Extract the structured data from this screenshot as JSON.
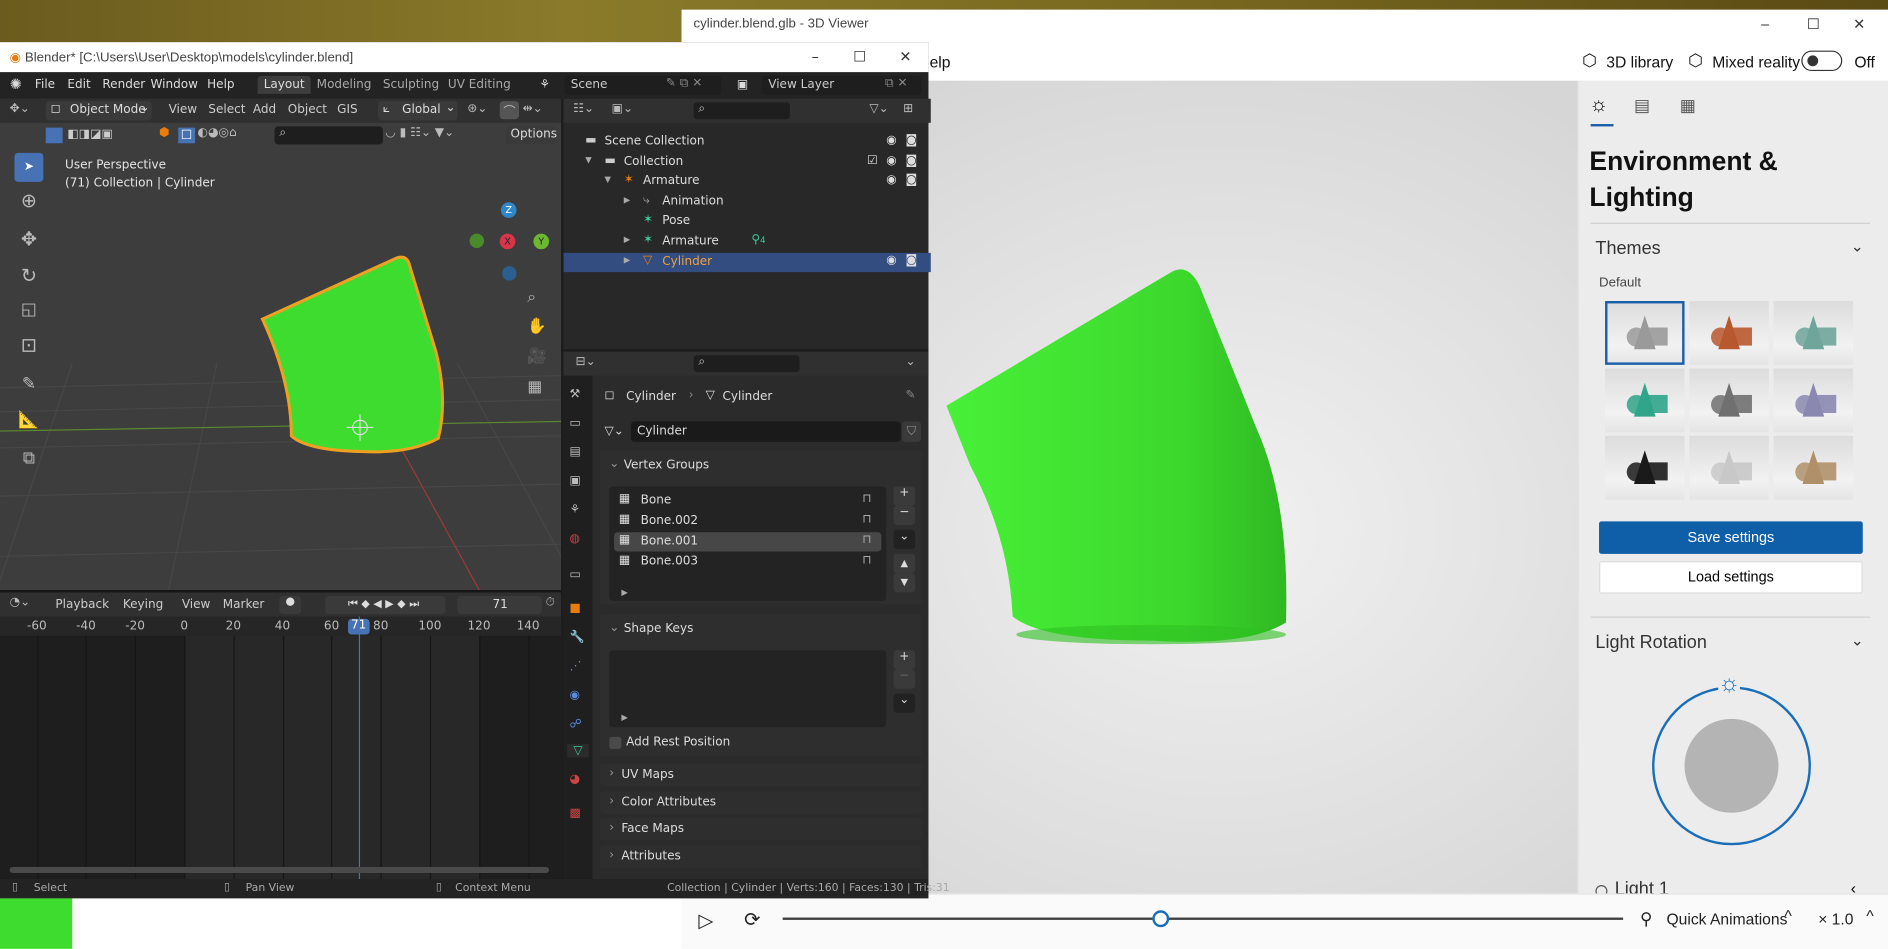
{
  "viewer": {
    "title": "cylinder.blend.glb - 3D Viewer",
    "menu_partial": "elp",
    "library_label": "3D library",
    "mixed_reality_label": "Mixed reality",
    "mixed_reality_state": "Off",
    "panel": {
      "tabs": [
        "sun-icon",
        "stats-icon",
        "grid-icon"
      ],
      "title_line1": "Environment &",
      "title_line2": "Lighting",
      "themes_label": "Themes",
      "themes_selected": "Default",
      "theme_colors": [
        "#9a9a9a",
        "#b8582e",
        "#6fa59a",
        "#2fa58a",
        "#707070",
        "#8a88b0",
        "#1a1a1a",
        "#c8c8c8",
        "#b0906a"
      ],
      "save_label": "Save settings",
      "load_label": "Load settings",
      "light_rotation_label": "Light Rotation",
      "light1_label": "Light 1"
    },
    "playback": {
      "progress": 0.45,
      "quick_animations_label": "Quick Animations",
      "speed": "× 1.0"
    },
    "model_color": "#3ddc2e"
  },
  "blender": {
    "title": "Blender* [C:\\Users\\User\\Desktop\\models\\cylinder.blend]",
    "menu": [
      "File",
      "Edit",
      "Render",
      "Window",
      "Help"
    ],
    "workspaces": [
      "Layout",
      "Modeling",
      "Sculpting",
      "UV Editing"
    ],
    "active_workspace": "Layout",
    "scene": "Scene",
    "view_layer": "View Layer",
    "viewport": {
      "mode": "Object Mode",
      "menus": [
        "View",
        "Select",
        "Add",
        "Object",
        "GIS"
      ],
      "orientation": "Global",
      "options_label": "Options",
      "overlay_line1": "User Perspective",
      "overlay_line2": "(71) Collection | Cylinder",
      "gizmo": {
        "z": "Z",
        "y": "Y",
        "x": "X"
      }
    },
    "outliner": [
      {
        "label": "Scene Collection",
        "depth": 0
      },
      {
        "label": "Collection",
        "depth": 1
      },
      {
        "label": "Armature",
        "depth": 2
      },
      {
        "label": "Animation",
        "depth": 3
      },
      {
        "label": "Pose",
        "depth": 3
      },
      {
        "label": "Armature",
        "depth": 3,
        "badge": "4"
      },
      {
        "label": "Cylinder",
        "depth": 3,
        "selected": true
      }
    ],
    "properties": {
      "breadcrumb": [
        "Cylinder",
        "Cylinder"
      ],
      "mesh_name": "Cylinder",
      "vertex_groups_label": "Vertex Groups",
      "vertex_groups": [
        "Bone",
        "Bone.002",
        "Bone.001",
        "Bone.003"
      ],
      "active_vertex_group": "Bone.001",
      "shape_keys_label": "Shape Keys",
      "add_rest_position_label": "Add Rest Position",
      "collapsed_panels": [
        "UV Maps",
        "Color Attributes",
        "Face Maps",
        "Attributes"
      ]
    },
    "timeline": {
      "menus": [
        "Playback",
        "Keying",
        "View",
        "Marker"
      ],
      "current_frame": "71",
      "ticks": [
        "-60",
        "-40",
        "-20",
        "0",
        "20",
        "40",
        "60",
        "80",
        "100",
        "120",
        "140"
      ]
    },
    "status": {
      "select": "Select",
      "pan": "Pan View",
      "context": "Context Menu",
      "stats": "Collection | Cylinder | Verts:160 | Faces:130 | Tris:31"
    }
  }
}
